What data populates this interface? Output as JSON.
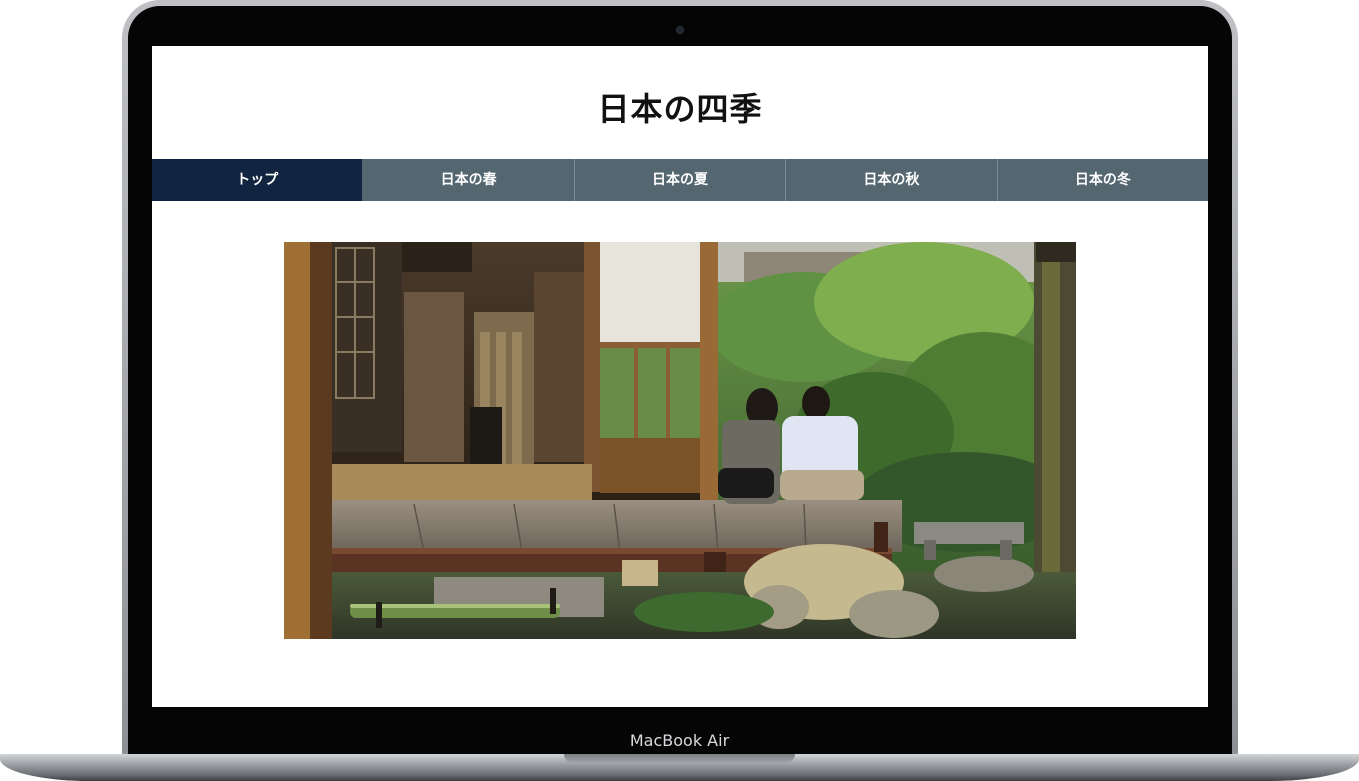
{
  "device": {
    "model_label": "MacBook Air",
    "bezel_color": "#050505",
    "body_color": "#a1a4a9"
  },
  "site": {
    "title": "日本の四季"
  },
  "nav": {
    "active_color": "#122540",
    "inactive_color": "#546670",
    "items": [
      {
        "label": "トップ",
        "active": true
      },
      {
        "label": "日本の春",
        "active": false
      },
      {
        "label": "日本の夏",
        "active": false
      },
      {
        "label": "日本の秋",
        "active": false
      },
      {
        "label": "日本の冬",
        "active": false
      }
    ]
  },
  "hero": {
    "icon": "photo-japanese-house-garden"
  }
}
